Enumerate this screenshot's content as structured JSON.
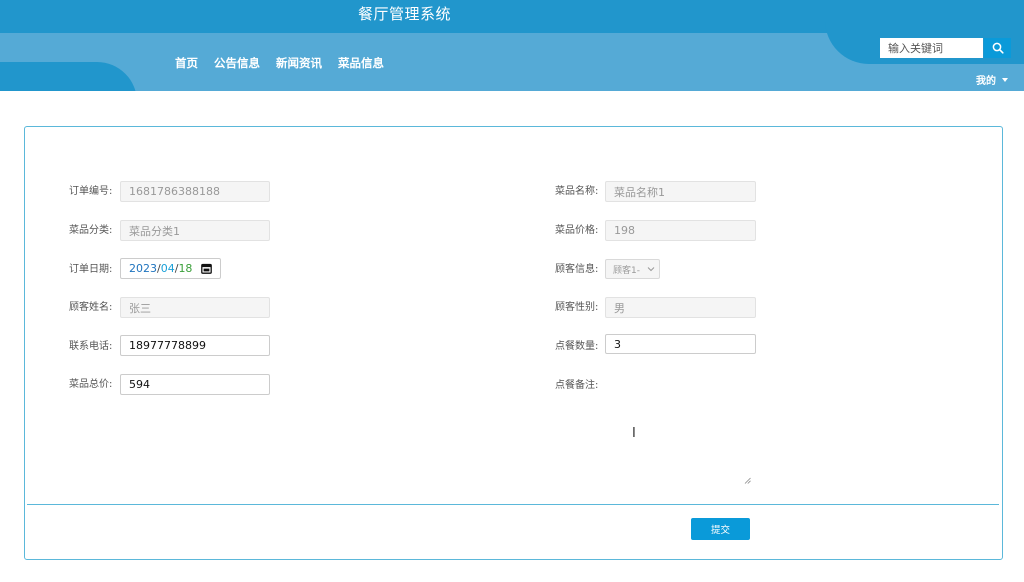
{
  "header": {
    "title": "餐厅管理系统",
    "nav": [
      "首页",
      "公告信息",
      "新闻资讯",
      "菜品信息"
    ],
    "search_placeholder": "输入关键词",
    "search_icon": "search-icon",
    "user_menu_label": "我的"
  },
  "form": {
    "order_no": {
      "label": "订单编号:",
      "value": "1681786388188"
    },
    "dish_name": {
      "label": "菜品名称:",
      "value": "菜品名称1"
    },
    "dish_category": {
      "label": "菜品分类:",
      "value": "菜品分类1"
    },
    "dish_price": {
      "label": "菜品价格:",
      "value": "198"
    },
    "order_date": {
      "label": "订单日期:",
      "year": "2023",
      "month": "04",
      "day": "18",
      "separator": "/"
    },
    "customer_info": {
      "label": "顾客信息:",
      "value": "顾客1-"
    },
    "customer_name": {
      "label": "顾客姓名:",
      "value": "张三"
    },
    "customer_gender": {
      "label": "顾客性别:",
      "value": "男"
    },
    "phone": {
      "label": "联系电话:",
      "value": "18977778899"
    },
    "quantity": {
      "label": "点餐数量:",
      "value": "3"
    },
    "total_price": {
      "label": "菜品总价:",
      "value": "594"
    },
    "remarks": {
      "label": "点餐备注:",
      "value": ""
    },
    "submit_label": "提交"
  },
  "colors": {
    "header_dark": "#2196cc",
    "header_light": "#55aad6",
    "accent": "#0a9ad9",
    "panel_border": "#5bb8da"
  }
}
